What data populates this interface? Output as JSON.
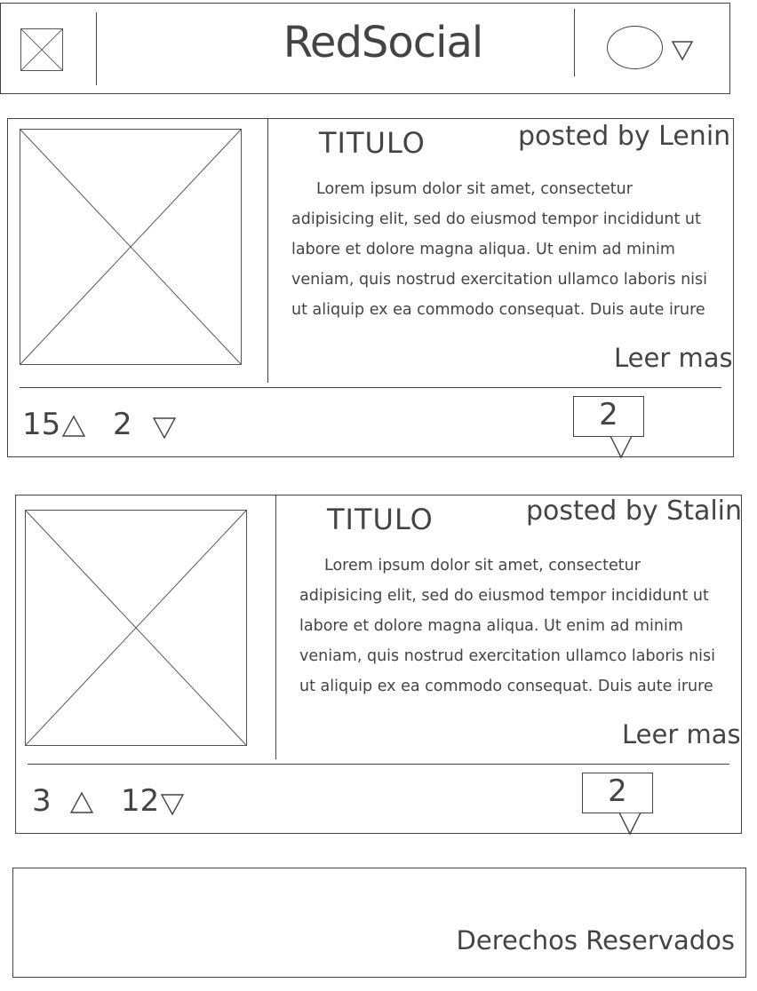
{
  "header": {
    "brand": "RedSocial",
    "logo_icon": "image-placeholder-icon",
    "avatar_icon": "user-avatar-icon",
    "menu_icon": "chevron-down-icon"
  },
  "posts": [
    {
      "title": "TITULO",
      "author": "posted by Lenin",
      "body": "Lorem ipsum dolor sit amet, consectetur\nadipisicing elit, sed do eiusmod tempor incididunt ut\nlabore et dolore magna aliqua. Ut enim ad minim\nveniam, quis nostrud exercitation ullamco laboris nisi\nut aliquip ex ea commodo consequat. Duis aute irure",
      "read_more": "Leer mas",
      "upvotes": "15",
      "downvotes": "2",
      "comments": "2"
    },
    {
      "title": "TITULO",
      "author": "posted by Stalin",
      "body": "Lorem ipsum dolor sit amet, consectetur\nadipisicing elit, sed do eiusmod tempor incididunt ut\nlabore et dolore magna aliqua. Ut enim ad minim\nveniam, quis nostrud exercitation ullamco laboris nisi\nut aliquip ex ea commodo consequat. Duis aute irure",
      "read_more": "Leer mas",
      "upvotes": "3",
      "downvotes": "12",
      "comments": "2"
    }
  ],
  "footer": {
    "copyright": "Derechos Reservados"
  },
  "colors": {
    "stroke": "#444444",
    "background": "#ffffff"
  }
}
